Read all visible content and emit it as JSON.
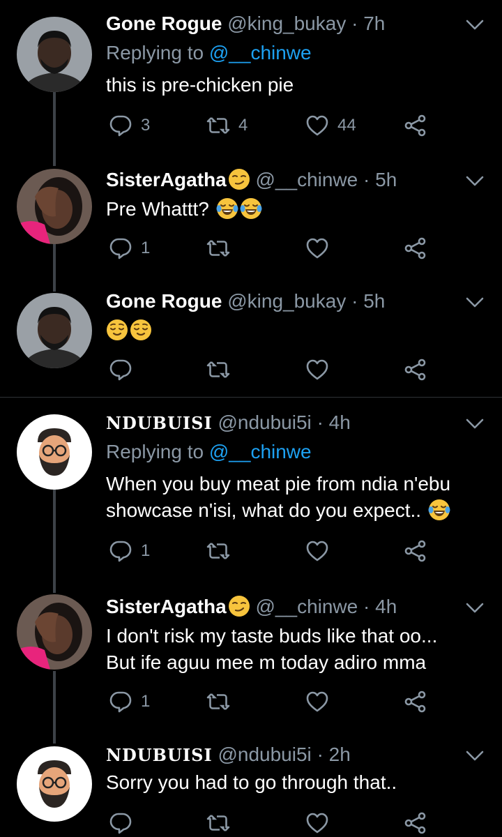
{
  "tweets": [
    {
      "name": "Gone Rogue",
      "handle": "@king_bukay",
      "dot": "·",
      "time": "7h",
      "replying_prefix": "Replying to ",
      "replying_to": "@__chinwe",
      "text_lines": [
        "this is pre-chicken pie"
      ],
      "counts": {
        "reply": "3",
        "retweet": "4",
        "like": "44"
      }
    },
    {
      "name": "SisterAgatha",
      "handle": "@__chinwe",
      "dot": "·",
      "time": "5h",
      "text_lines": [
        "Pre Whattt?"
      ],
      "counts": {
        "reply": "1",
        "retweet": "",
        "like": ""
      }
    },
    {
      "name": "Gone Rogue",
      "handle": "@king_bukay",
      "dot": "·",
      "time": "5h",
      "text_lines": [
        ""
      ],
      "counts": {
        "reply": "",
        "retweet": "",
        "like": ""
      }
    },
    {
      "name": "NDUBUISI",
      "handle": "@ndubui5i",
      "dot": "·",
      "time": "4h",
      "replying_prefix": "Replying to ",
      "replying_to": "@__chinwe",
      "text_lines": [
        "When you buy meat pie from ndia n'ebu",
        "showcase n'isi, what do you expect.."
      ],
      "counts": {
        "reply": "1",
        "retweet": "",
        "like": ""
      }
    },
    {
      "name": "SisterAgatha",
      "handle": "@__chinwe",
      "dot": "·",
      "time": "4h",
      "text_lines": [
        "I don't risk my taste buds like that oo...",
        "But ife aguu mee m today adiro mma"
      ],
      "counts": {
        "reply": "1",
        "retweet": "",
        "like": ""
      }
    },
    {
      "name": "NDUBUISI",
      "handle": "@ndubui5i",
      "dot": "·",
      "time": "2h",
      "text_lines": [
        "Sorry you had to go through that.."
      ],
      "counts": {
        "reply": "",
        "retweet": "",
        "like": ""
      }
    }
  ],
  "colors": {
    "background": "#000000",
    "secondary": "#8b98a5",
    "link": "#1da1f2",
    "thread_line": "#3d4248"
  },
  "icons": [
    "reply-icon",
    "retweet-icon",
    "like-icon",
    "share-icon",
    "caret-down-icon",
    "smirk-emoji",
    "tears-of-joy-emoji",
    "relieved-emoji"
  ]
}
